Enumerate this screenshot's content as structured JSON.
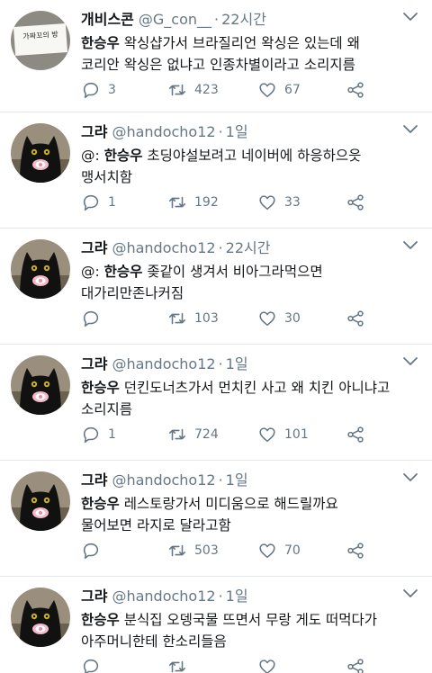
{
  "tweets": [
    {
      "name": "개비스콘",
      "handle": "@G_con__",
      "dot": "·",
      "time": "22시간",
      "avatar_icon": "paper-sign-avatar",
      "avatar_sign_text": "가짜꼬의 방",
      "mention": "",
      "author_bold": "한승우",
      "line1_rest": " 왁싱샵가서 브라질리언 왁싱은 있는데 왜",
      "line2": "코리안 왁싱은 없냐고 인종차별이라고 소리지름",
      "replies": "3",
      "retweets": "423",
      "likes": "67"
    },
    {
      "name": "그랴",
      "handle": "@handocho12",
      "dot": "·",
      "time": "1일",
      "avatar_icon": "black-cat-pacifier-avatar",
      "mention": "@:",
      "author_bold": "한승우",
      "line1_rest": " 초딩야설보려고 네이버에 하응하으읏",
      "line2": "맹서치함",
      "replies": "1",
      "retweets": "192",
      "likes": "33"
    },
    {
      "name": "그랴",
      "handle": "@handocho12",
      "dot": "·",
      "time": "22시간",
      "avatar_icon": "black-cat-pacifier-avatar",
      "mention": "@:",
      "author_bold": "한승우",
      "line1_rest": " 좆같이 생겨서 비아그라먹으면",
      "line2": "대가리만존나커짐",
      "replies": "",
      "retweets": "103",
      "likes": "30"
    },
    {
      "name": "그랴",
      "handle": "@handocho12",
      "dot": "·",
      "time": "1일",
      "avatar_icon": "black-cat-pacifier-avatar",
      "mention": "",
      "author_bold": "한승우",
      "line1_rest": " 던킨도너츠가서 먼치킨 사고 왜 치킨 아니냐고",
      "line2": "소리지름",
      "replies": "1",
      "retweets": "724",
      "likes": "101"
    },
    {
      "name": "그랴",
      "handle": "@handocho12",
      "dot": "·",
      "time": "1일",
      "avatar_icon": "black-cat-pacifier-avatar",
      "mention": "",
      "author_bold": "한승우",
      "line1_rest": " 레스토랑가서 미디움으로 해드릴까요",
      "line2": "물어보면 라지로 달라고함",
      "replies": "",
      "retweets": "503",
      "likes": "70"
    },
    {
      "name": "그랴",
      "handle": "@handocho12",
      "dot": "·",
      "time": "1일",
      "avatar_icon": "black-cat-pacifier-avatar",
      "mention": "",
      "author_bold": "한승우",
      "line1_rest": " 분식집 오뎅국물 뜨면서 무랑 게도 떠먹다가",
      "line2": "아주머니한테 한소리들음",
      "replies": "",
      "retweets": "",
      "likes": ""
    }
  ],
  "colors": {
    "text": "#14171a",
    "secondary": "#657786",
    "divider": "#e1e8ed",
    "icon": "#657786"
  }
}
